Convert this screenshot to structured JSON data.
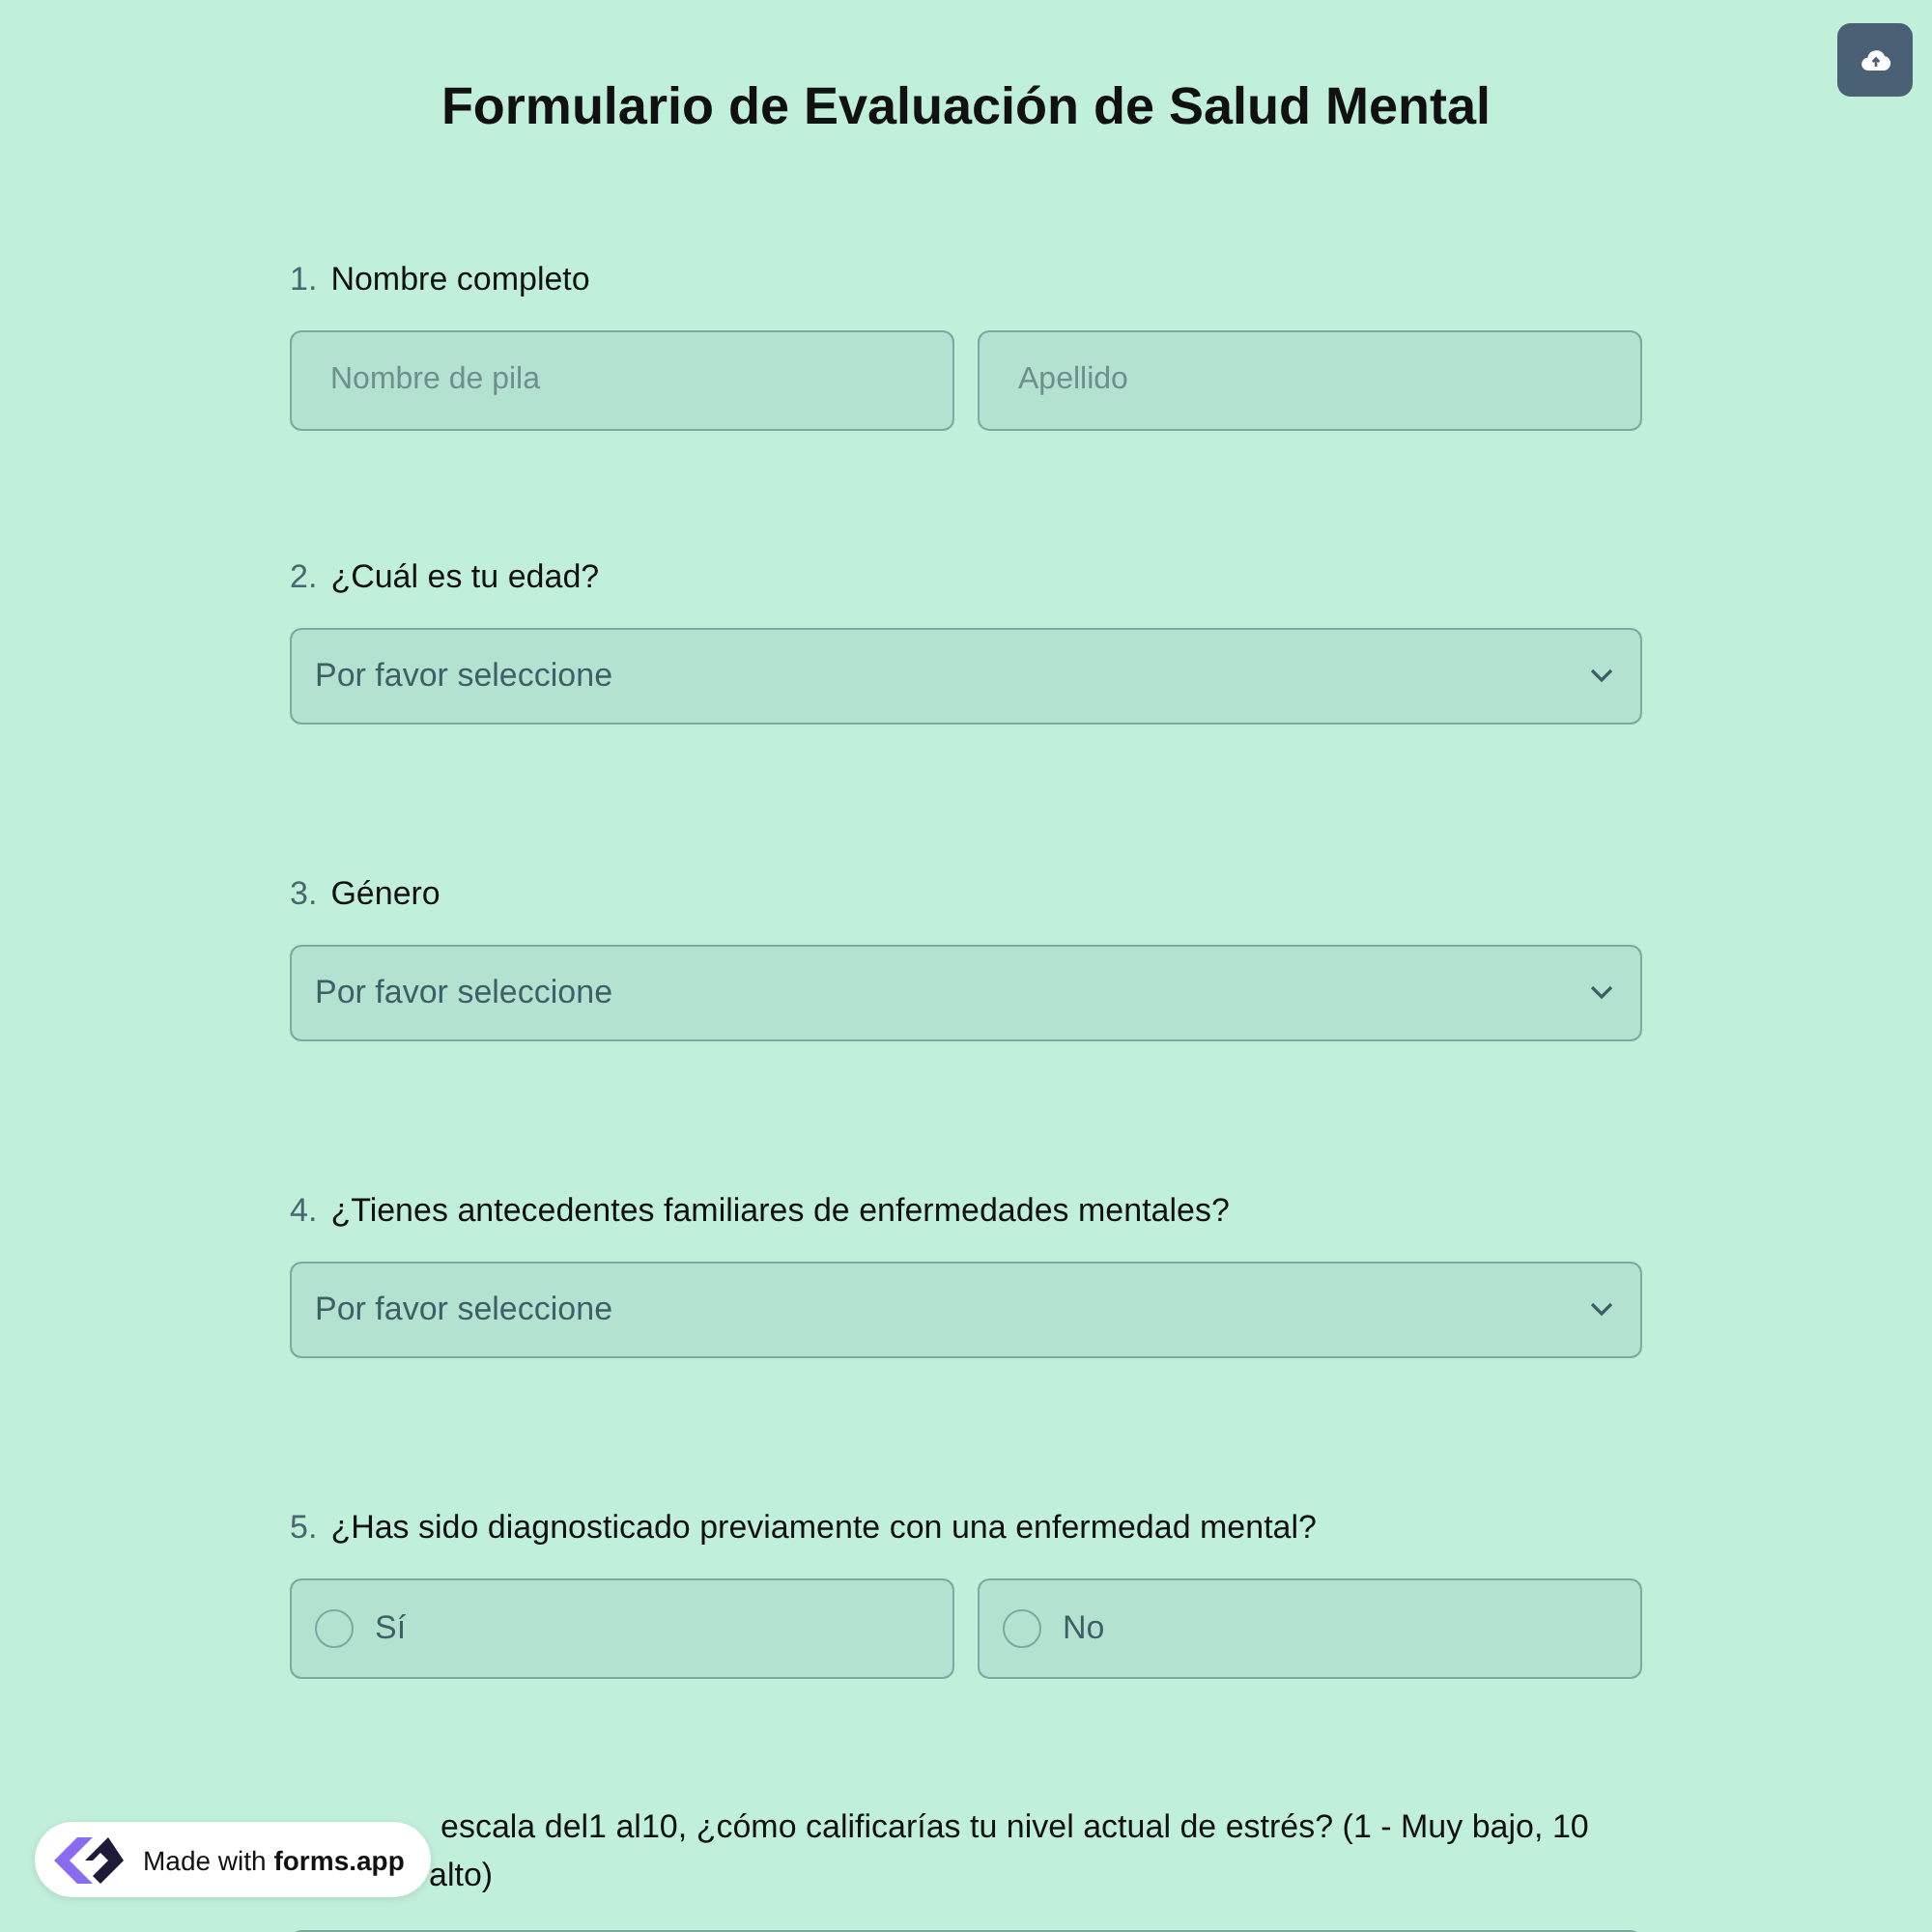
{
  "title": "Formulario de Evaluación de Salud Mental",
  "questions": [
    {
      "kind": "name",
      "number": "1.",
      "label": "Nombre completo",
      "fields": [
        {
          "placeholder": "Nombre de pila"
        },
        {
          "placeholder": "Apellido"
        }
      ]
    },
    {
      "kind": "select",
      "number": "2.",
      "label": "¿Cuál es tu edad?",
      "placeholder": "Por favor seleccione"
    },
    {
      "kind": "select",
      "number": "3.",
      "label": "Género",
      "placeholder": "Por favor seleccione"
    },
    {
      "kind": "select",
      "number": "4.",
      "label": "¿Tienes antecedentes familiares de enfermedades mentales?",
      "placeholder": "Por favor seleccione"
    },
    {
      "kind": "radio",
      "number": "5.",
      "label": "¿Has sido diagnosticado previamente con una enfermedad mental?",
      "options": [
        {
          "label": "Sí",
          "selected": false
        },
        {
          "label": "No",
          "selected": false
        }
      ]
    },
    {
      "kind": "scale",
      "lines": [
        "escala del1 al10, ¿cómo calificarías tu nivel actual de estrés? (1 - Muy bajo, 10",
        "alto)"
      ]
    }
  ],
  "badge": {
    "prefix": "Made with",
    "brand": "forms.app"
  }
}
